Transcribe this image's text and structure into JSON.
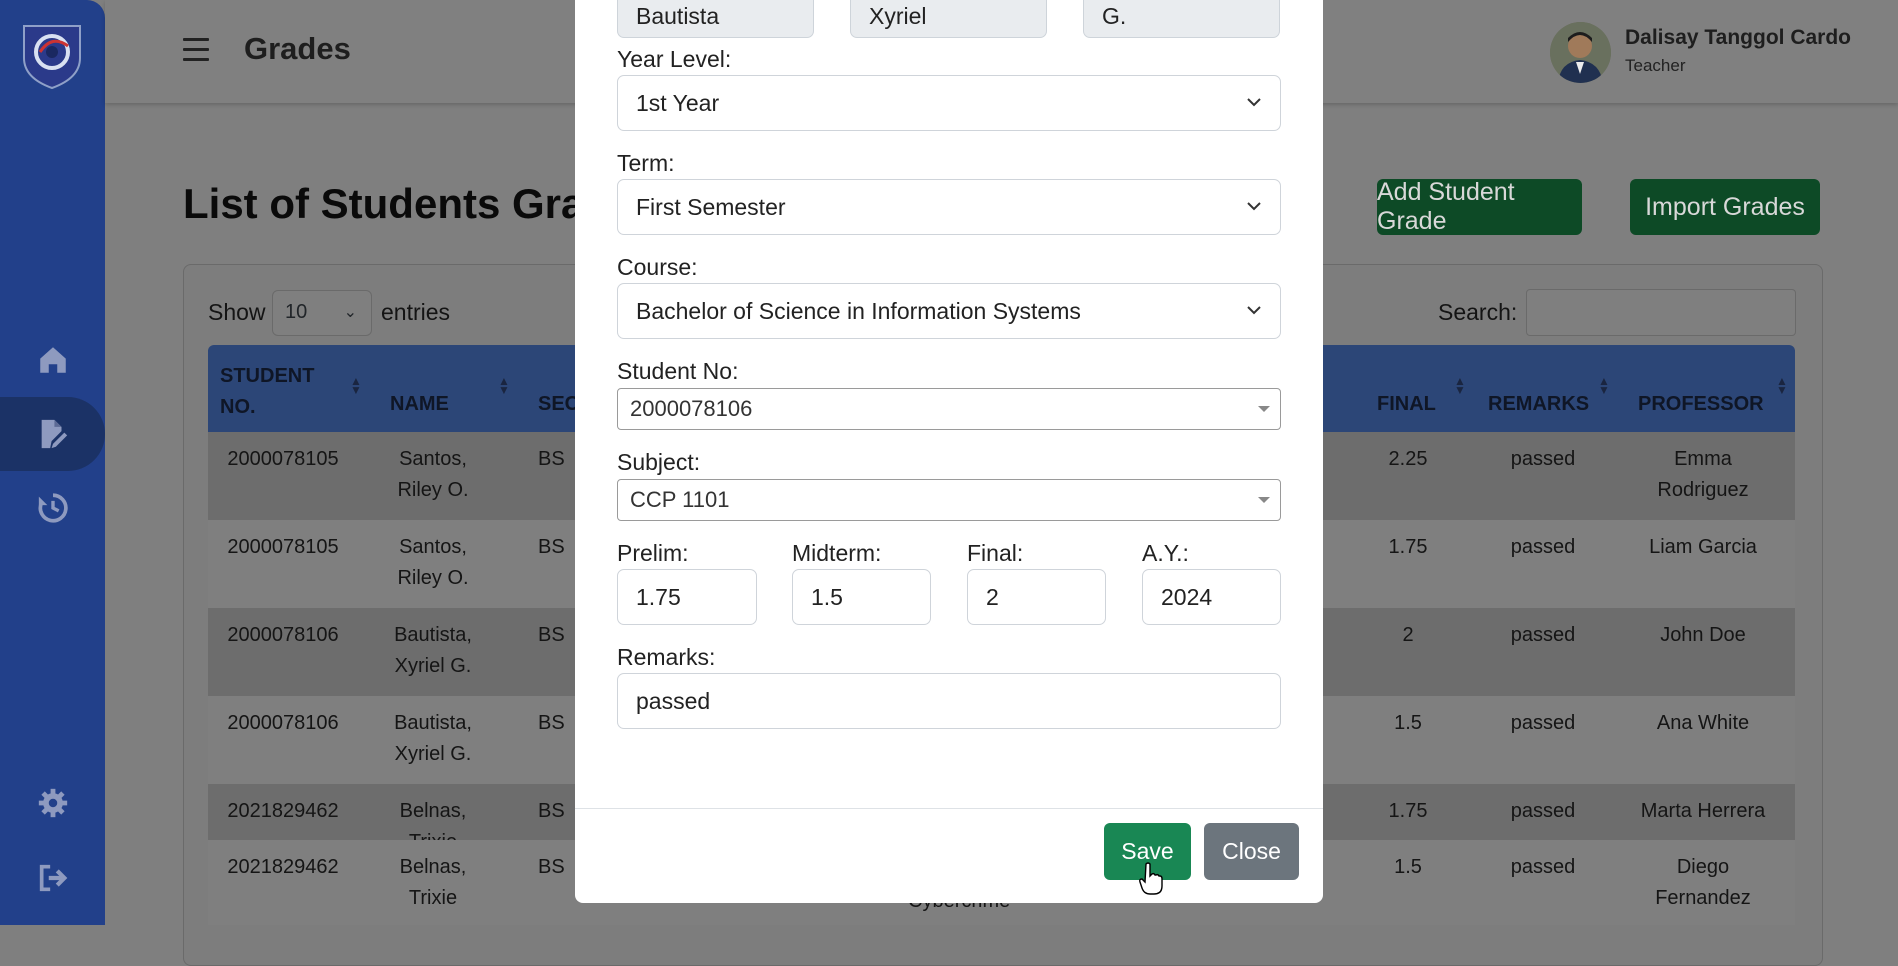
{
  "header": {
    "title": "Grades",
    "user": {
      "name": "Dalisay Tanggol Cardo",
      "role": "Teacher"
    }
  },
  "sidebar": {
    "items": [
      {
        "icon": "home-icon"
      },
      {
        "icon": "edit-grades-icon",
        "active": true
      },
      {
        "icon": "history-icon"
      },
      {
        "icon": "gear-icon"
      },
      {
        "icon": "logout-icon"
      }
    ]
  },
  "main": {
    "title": "List of Students Grad",
    "add_button": "Add Student Grade",
    "import_button": "Import Grades",
    "show_label": "Show",
    "show_value": "10",
    "entries_label": "entries",
    "search_label": "Search:",
    "table": {
      "headers": {
        "student_no": "STUDENT NO.",
        "name": "NAME",
        "section": "SEC",
        "final": "FINAL",
        "remarks": "REMARKS",
        "professor": "PROFESSOR"
      },
      "rows": [
        {
          "student_no": "2000078105",
          "name": "Santos, Riley O.",
          "section": "BS",
          "final": "2.25",
          "remarks": "passed",
          "professor": "Emma Rodriguez"
        },
        {
          "student_no": "2000078105",
          "name": "Santos, Riley O.",
          "section": "BS",
          "final": "1.75",
          "remarks": "passed",
          "professor": "Liam Garcia"
        },
        {
          "student_no": "2000078106",
          "name": "Bautista, Xyriel G.",
          "section": "BS",
          "final": "2",
          "remarks": "passed",
          "professor": "John Doe"
        },
        {
          "student_no": "2000078106",
          "name": "Bautista, Xyriel G.",
          "section": "BS",
          "final": "1.5",
          "remarks": "passed",
          "professor": "Ana White"
        },
        {
          "student_no": "2021829462",
          "name": "Belnas, Trixie",
          "section": "BS",
          "final": "1.75",
          "remarks": "passed",
          "professor": "Marta Herrera"
        },
        {
          "student_no": "2021829462",
          "name": "Belnas, Trixie",
          "section": "BS",
          "final": "1.5",
          "remarks": "passed",
          "professor": "Diego Fernandez",
          "subject_fragment": "Cybercrime"
        }
      ]
    }
  },
  "modal": {
    "last_name": "Bautista",
    "first_name": "Xyriel",
    "middle_initial": "G.",
    "year_level_label": "Year Level:",
    "year_level_value": "1st Year",
    "term_label": "Term:",
    "term_value": "First Semester",
    "course_label": "Course:",
    "course_value": "Bachelor of Science in Information Systems",
    "student_no_label": "Student No:",
    "student_no_value": "2000078106",
    "subject_label": "Subject:",
    "subject_value": "CCP 1101",
    "prelim_label": "Prelim:",
    "prelim_value": "1.75",
    "midterm_label": "Midterm:",
    "midterm_value": "1.5",
    "final_label": "Final:",
    "final_value": "2",
    "ay_label": "A.Y.:",
    "ay_value": "2024",
    "remarks_label": "Remarks:",
    "remarks_value": "passed",
    "save_button": "Save",
    "close_button": "Close"
  },
  "colors": {
    "sidebar": "#22408a",
    "primary_green": "#198754",
    "close_grey": "#6c757d",
    "table_header": "#2c4677"
  }
}
